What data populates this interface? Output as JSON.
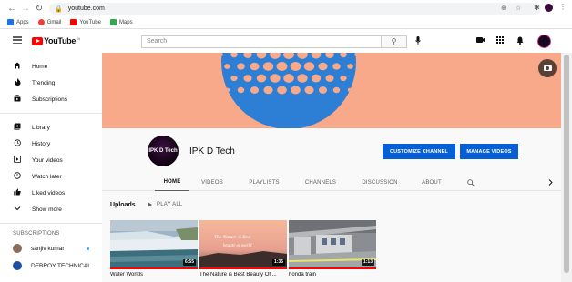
{
  "browser": {
    "url": "youtube.com",
    "bookmarks": [
      {
        "label": "Apps",
        "icon": "apps-grid-icon",
        "color": "#1a73e8"
      },
      {
        "label": "Gmail",
        "icon": "gmail-icon",
        "color": "#ea4335"
      },
      {
        "label": "YouTube",
        "icon": "youtube-icon",
        "color": "#ff0000"
      },
      {
        "label": "Maps",
        "icon": "maps-icon",
        "color": "#34a853"
      }
    ]
  },
  "header": {
    "logo_text": "YouTube",
    "logo_country": "IN",
    "search_placeholder": "Search"
  },
  "sidebar": {
    "items": [
      {
        "label": "Home",
        "icon": "home-icon"
      },
      {
        "label": "Trending",
        "icon": "trending-icon"
      },
      {
        "label": "Subscriptions",
        "icon": "subscriptions-icon"
      },
      {
        "label": "Library",
        "icon": "library-icon"
      },
      {
        "label": "History",
        "icon": "history-icon"
      },
      {
        "label": "Your videos",
        "icon": "your-videos-icon"
      },
      {
        "label": "Watch later",
        "icon": "watch-later-icon"
      },
      {
        "label": "Liked videos",
        "icon": "liked-videos-icon"
      },
      {
        "label": "Show more",
        "icon": "chevron-down-icon"
      }
    ],
    "subscriptions_heading": "SUBSCRIPTIONS",
    "subscriptions": [
      {
        "label": "sanjiv kumar",
        "avatar_color": "#8a6d5b"
      },
      {
        "label": "DEBROY TECHNICAL",
        "avatar_color": "#1e4fa3"
      }
    ]
  },
  "channel": {
    "name": "IPK D Tech",
    "avatar_text": "IPK D Tech",
    "customize_label": "CUSTOMIZE CHANNEL",
    "manage_label": "MANAGE VIDEOS",
    "banner_color": "#f8a98a",
    "globe_color": "#2d7fd6"
  },
  "tabs": [
    "HOME",
    "VIDEOS",
    "PLAYLISTS",
    "CHANNELS",
    "DISCUSSION",
    "ABOUT"
  ],
  "content": {
    "uploads_title": "Uploads",
    "play_all_label": "PLAY ALL",
    "videos": [
      {
        "title": "Water Worlds",
        "duration": "6:55",
        "watched": 1.0
      },
      {
        "title": "The Nature is Best Beauty Of ...",
        "duration": "1:35",
        "watched": 1.0,
        "overlay_text_1": "The Nature is Best",
        "overlay_text_2": "beauty of world"
      },
      {
        "title": "honda train",
        "duration": "1:13",
        "watched": 1.0
      }
    ]
  }
}
